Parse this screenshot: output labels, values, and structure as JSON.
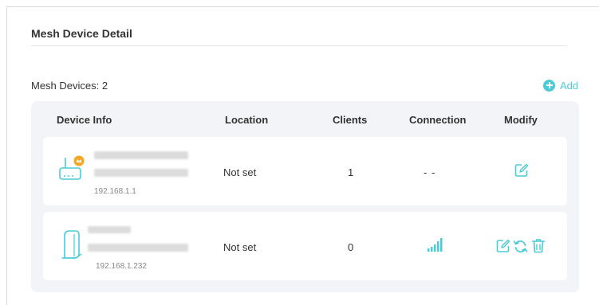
{
  "section": {
    "title": "Mesh Device Detail",
    "device_count_label": "Mesh Devices: 2",
    "add_label": "Add"
  },
  "table": {
    "headers": {
      "device_info": "Device Info",
      "location": "Location",
      "clients": "Clients",
      "connection": "Connection",
      "modify": "Modify"
    },
    "rows": [
      {
        "ip": "192.168.1.1",
        "location": "Not set",
        "clients": "1",
        "connection": "- -",
        "device_icon": "router-icon",
        "modify_icons": [
          "edit-icon"
        ]
      },
      {
        "ip": "192.168.1.232",
        "location": "Not set",
        "clients": "0",
        "connection_icon": "signal-strength-icon",
        "device_icon": "satellite-device-icon",
        "modify_icons": [
          "edit-icon",
          "reboot-icon",
          "delete-icon"
        ]
      }
    ]
  },
  "colors": {
    "accent": "#4acbd6",
    "main_badge": "#f5a623",
    "panel_bg": "#f2f4f7"
  }
}
